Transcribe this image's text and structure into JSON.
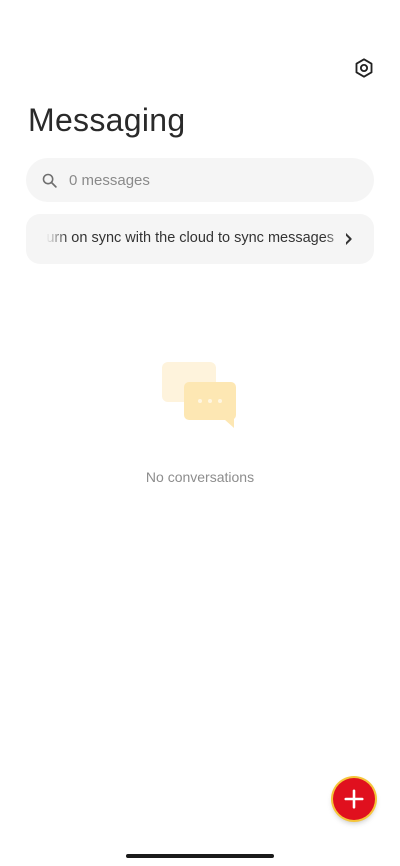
{
  "header": {
    "title": "Messaging",
    "settings_icon": "gear-icon"
  },
  "search": {
    "placeholder": "0 messages",
    "value": "",
    "icon": "search-icon"
  },
  "sync_banner": {
    "text": "Turn on sync with the cloud to sync messages",
    "icon": "chevron-right-icon"
  },
  "empty_state": {
    "illustration": "chat-bubbles-icon",
    "text": "No conversations"
  },
  "fab": {
    "icon": "plus-icon"
  },
  "colors": {
    "fab": "#e0101e",
    "fab_ring": "#f5c53a",
    "surface": "#f5f5f5",
    "illustration": "#fde7b3"
  }
}
